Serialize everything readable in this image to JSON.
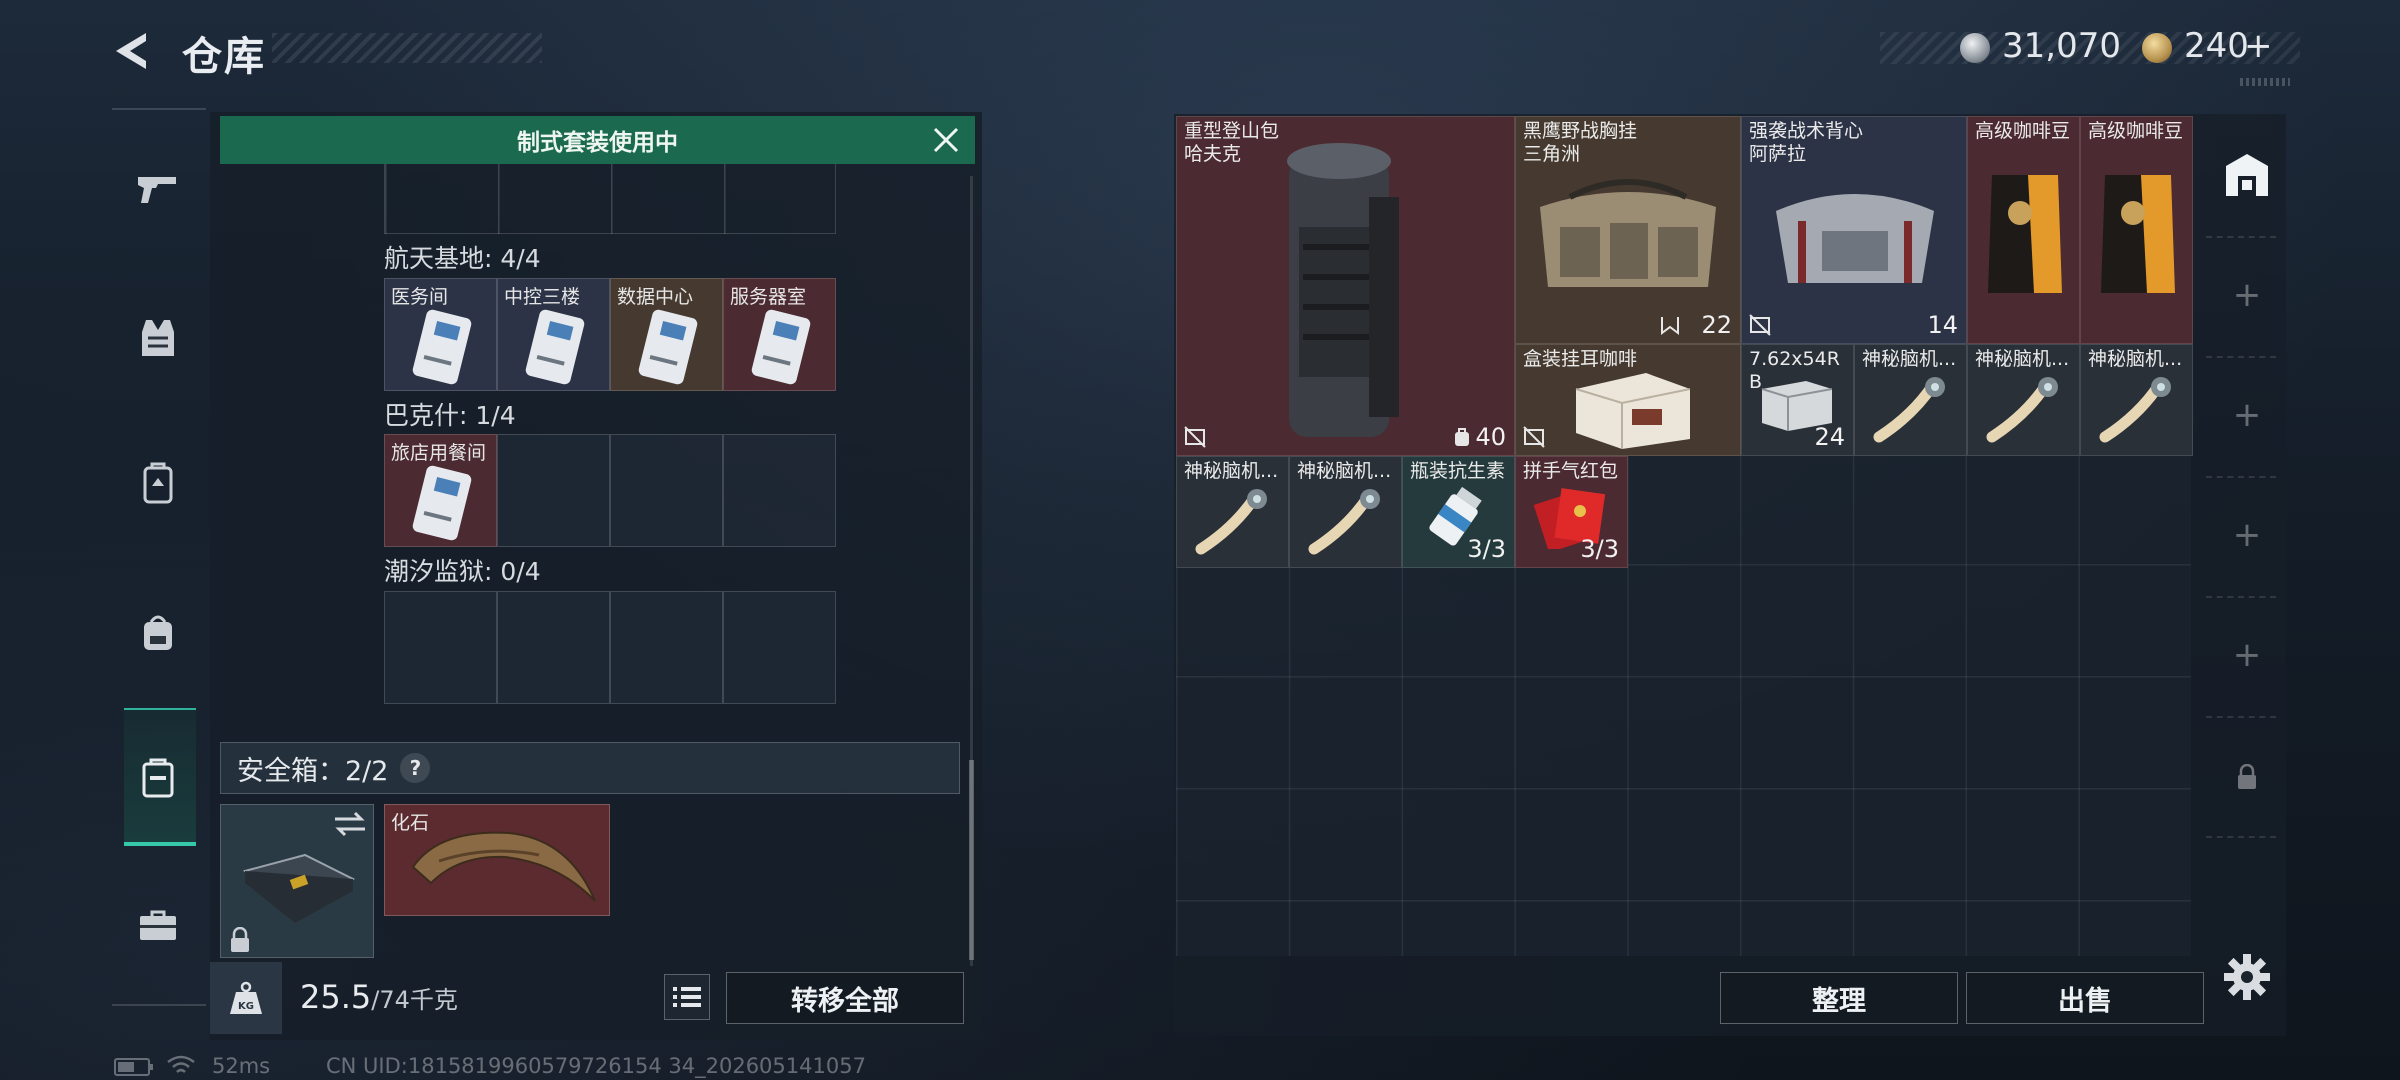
{
  "header": {
    "title": "仓库"
  },
  "currency": {
    "silver": "31,070",
    "gold": "240",
    "gold_plus": "+"
  },
  "banner": {
    "text": "制式套装使用中"
  },
  "sections": [
    {
      "title": "航天基地: 4/4",
      "slots": [
        "医务间",
        "中控三楼",
        "数据中心",
        "服务器室"
      ]
    },
    {
      "title": "巴克什: 1/4",
      "slots": [
        "旅店用餐间"
      ]
    },
    {
      "title": "潮汐监狱: 0/4",
      "slots": []
    }
  ],
  "safebox": {
    "label": "安全箱：2/2",
    "help": "?",
    "fossil_label": "化石"
  },
  "weight": {
    "current": "25.5",
    "max": "/74千克"
  },
  "buttons": {
    "transfer_all": "转移全部",
    "sort": "整理",
    "sell": "出售"
  },
  "items": [
    {
      "label": "重型登山包\n哈夫克",
      "count": "40"
    },
    {
      "label": "黑鹰野战胸挂\n三角洲",
      "count": "22"
    },
    {
      "label": "强袭战术背心\n阿萨拉",
      "count": "14"
    },
    {
      "label": "高级咖啡豆"
    },
    {
      "label": "高级咖啡豆"
    },
    {
      "label": "盒装挂耳咖啡"
    },
    {
      "label": "7.62x54R\nB",
      "count": "24"
    },
    {
      "label": "神秘脑机..."
    },
    {
      "label": "神秘脑机..."
    },
    {
      "label": "神秘脑机..."
    },
    {
      "label": "神秘脑机..."
    },
    {
      "label": "神秘脑机..."
    },
    {
      "label": "瓶装抗生素",
      "count": "3/3"
    },
    {
      "label": "拼手气红包",
      "count": "3/3"
    }
  ],
  "status": {
    "ping": "52ms",
    "uid": "CN UID:1815819960579726154 34_202605141057"
  },
  "colors": {
    "accent": "#35c9a9",
    "banner": "#1b6a4f",
    "item_red": "#4b2a31",
    "item_brown": "#463a30",
    "item_blue": "#2c3346"
  }
}
